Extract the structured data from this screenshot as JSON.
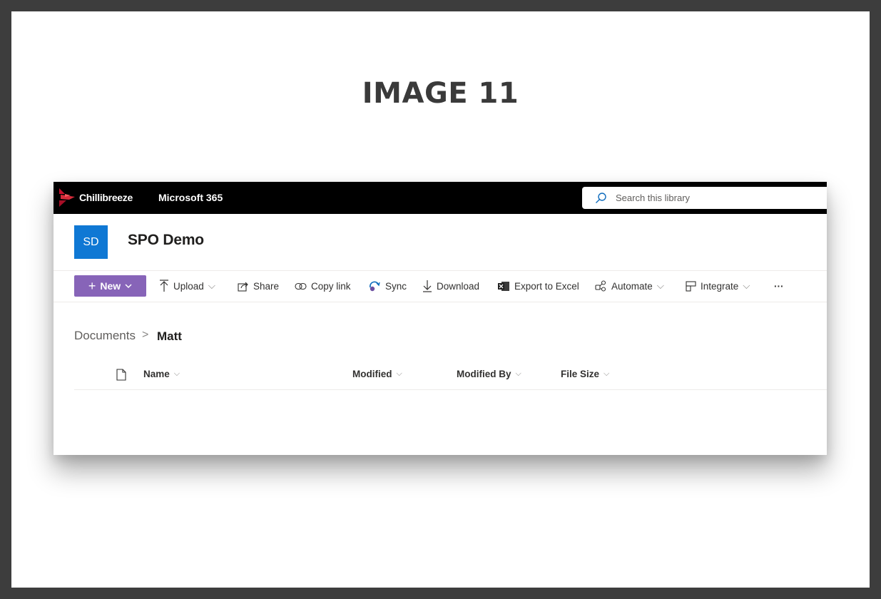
{
  "image_title": "IMAGE 11",
  "suite_bar": {
    "brand": "Chillibreeze",
    "app": "Microsoft 365",
    "search_placeholder": "Search this library"
  },
  "site": {
    "logo_initials": "SD",
    "logo_color": "#0f78d4",
    "title": "SPO Demo"
  },
  "command_bar": {
    "new_label": "New",
    "new_color": "#8764b8",
    "items": [
      {
        "label": "Upload",
        "icon": "upload-icon",
        "has_dropdown": true
      },
      {
        "label": "Share",
        "icon": "share-icon",
        "has_dropdown": false
      },
      {
        "label": "Copy link",
        "icon": "link-icon",
        "has_dropdown": false
      },
      {
        "label": "Sync",
        "icon": "sync-icon",
        "has_dropdown": false
      },
      {
        "label": "Download",
        "icon": "download-icon",
        "has_dropdown": false
      },
      {
        "label": "Export to Excel",
        "icon": "excel-icon",
        "has_dropdown": false
      },
      {
        "label": "Automate",
        "icon": "automate-icon",
        "has_dropdown": true
      },
      {
        "label": "Integrate",
        "icon": "integrate-icon",
        "has_dropdown": true
      },
      {
        "label": "···",
        "icon": "more-icon",
        "has_dropdown": false
      }
    ]
  },
  "breadcrumb": {
    "root": "Documents",
    "separator": ">",
    "current": "Matt"
  },
  "columns": [
    {
      "label": "Name"
    },
    {
      "label": "Modified"
    },
    {
      "label": "Modified By"
    },
    {
      "label": "File Size"
    }
  ]
}
